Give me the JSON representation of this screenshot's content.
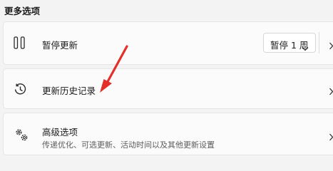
{
  "section": {
    "title": "更多选项"
  },
  "pause": {
    "label": "暂停更新",
    "dropdown_value": "暂停 1 周",
    "icon": "pause-icon"
  },
  "history": {
    "label": "更新历史记录",
    "icon": "history-icon"
  },
  "advanced": {
    "label": "高级选项",
    "description": "传递优化、可选更新、活动时间以及其他更新设置",
    "icon": "gears-icon"
  },
  "annotation": {
    "arrow_color": "#e3302b"
  }
}
